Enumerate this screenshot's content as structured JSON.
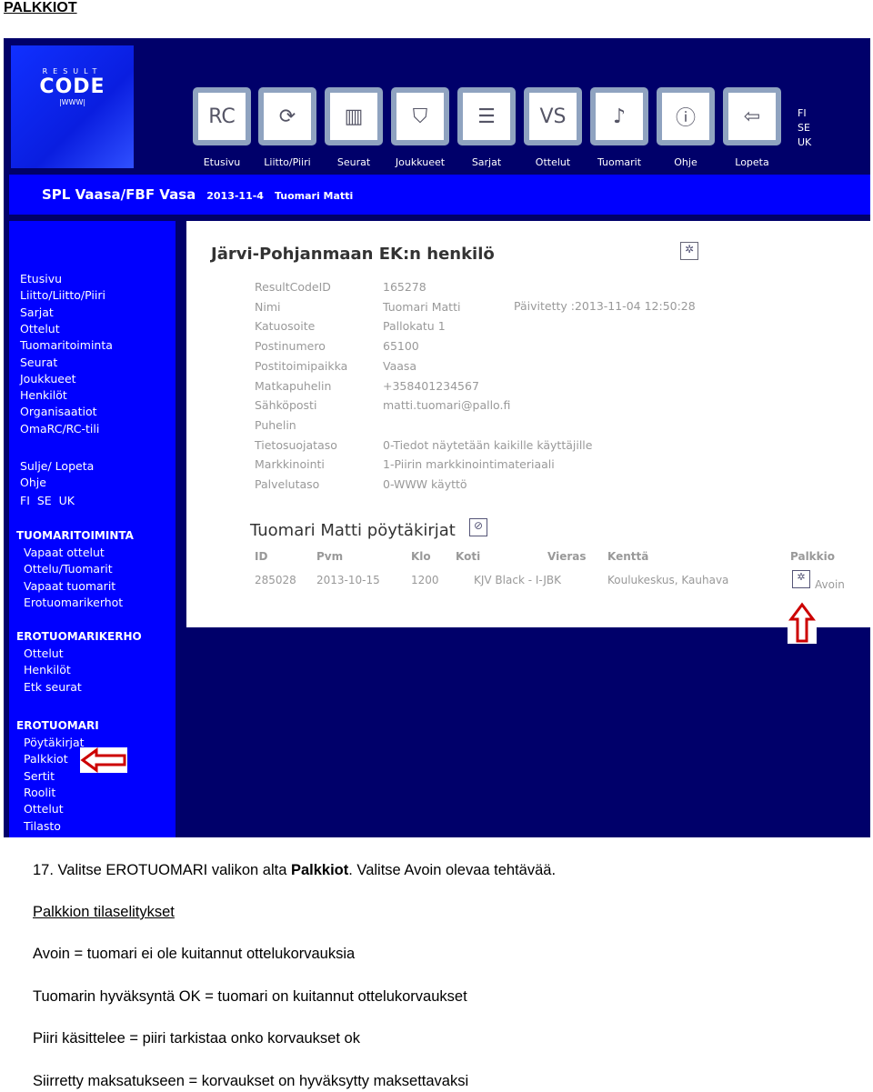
{
  "doc_title": "PALKKIOT",
  "logo": {
    "top": "RESULT",
    "main": "CODE",
    "sub": "|WWW|"
  },
  "nav": [
    {
      "label": "Etusivu",
      "icon": "resultcode-icon"
    },
    {
      "label": "Liitto/Piiri",
      "icon": "people-circle-icon"
    },
    {
      "label": "Seurat",
      "icon": "clubs-icon"
    },
    {
      "label": "Joukkueet",
      "icon": "team-shield-icon"
    },
    {
      "label": "Sarjat",
      "icon": "series-list-icon"
    },
    {
      "label": "Ottelut",
      "icon": "versus-icon"
    },
    {
      "label": "Tuomarit",
      "icon": "whistle-icon"
    },
    {
      "label": "Ohje",
      "icon": "info-icon"
    },
    {
      "label": "Lopeta",
      "icon": "exit-icon"
    }
  ],
  "languages": [
    "FI",
    "SE",
    "UK"
  ],
  "banner": {
    "org": "SPL Vaasa/FBF Vasa",
    "date": "2013-11-4",
    "user": "Tuomari Matti"
  },
  "sidebar": {
    "main": [
      "Etusivu",
      "Liitto/Liitto/Piiri",
      "Sarjat",
      "Ottelut",
      "Tuomaritoiminta",
      "Seurat",
      "Joukkueet",
      "Henkilöt",
      "Organisaatiot",
      "OmaRC/RC-tili"
    ],
    "misc": [
      "Sulje/ Lopeta",
      "Ohje"
    ],
    "langs": "FI  SE  UK",
    "sections": [
      {
        "title": "TUOMARITOIMINTA",
        "items": [
          "Vapaat ottelut",
          "Ottelu/Tuomarit",
          "Vapaat tuomarit",
          "Erotuomarikerhot"
        ]
      },
      {
        "title": "EROTUOMARIKERHO",
        "items": [
          "Ottelut",
          "Henkilöt",
          "Etk seurat"
        ]
      },
      {
        "title": "EROTUOMARI",
        "items": [
          "Pöytäkirjat",
          "Palkkiot",
          "Sertit",
          "Roolit",
          "Ottelut",
          "Tilasto"
        ]
      }
    ]
  },
  "profile": {
    "title": "Järvi-Pohjanmaan EK:n henkilö",
    "updated": "Päivitetty :2013-11-04 12:50:28",
    "fields": [
      [
        "ResultCodeID",
        "165278"
      ],
      [
        "Nimi",
        "Tuomari Matti"
      ],
      [
        "Katuosoite",
        "Pallokatu 1"
      ],
      [
        "Postinumero",
        "65100"
      ],
      [
        "Postitoimipaikka",
        "Vaasa"
      ],
      [
        "Matkapuhelin",
        "+358401234567"
      ],
      [
        "Sähköposti",
        "matti.tuomari@pallo.fi"
      ],
      [
        "Puhelin",
        ""
      ],
      [
        "Tietosuojataso",
        "0-Tiedot näytetään kaikille käyttäjille"
      ],
      [
        "Markkinointi",
        "1-Piirin markkinointimateriaali"
      ],
      [
        "Palvelutaso",
        "0-WWW käyttö"
      ]
    ]
  },
  "records": {
    "title": "Tuomari Matti pöytäkirjat",
    "headers": [
      "ID",
      "Pvm",
      "Klo",
      "Koti",
      "Vieras",
      "Kenttä",
      "Palkkio"
    ],
    "rows": [
      {
        "id": "285028",
        "date": "2013-10-15",
        "time": "1200",
        "match": "KJV Black - I-JBK",
        "field": "Koulukeskus, Kauhava",
        "fee": "Avoin"
      }
    ]
  },
  "instructions": {
    "step": "17.  Valitse EROTUOMARI valikon alta ",
    "bold": "Palkkiot",
    "rest": ". Valitse Avoin olevaa tehtävää.",
    "heading": "Palkkion tilaselitykset",
    "lines": [
      "Avoin = tuomari ei ole kuitannut ottelukorvauksia",
      "Tuomarin hyväksyntä OK = tuomari on kuitannut ottelukorvaukset",
      "Piiri käsittelee = piiri tarkistaa onko korvaukset ok",
      "Siirretty maksatukseen = korvaukset on hyväksytty maksettavaksi"
    ]
  },
  "colors": {
    "navy": "#00006a",
    "blue": "#0000ff",
    "arrow": "#cc0000"
  }
}
